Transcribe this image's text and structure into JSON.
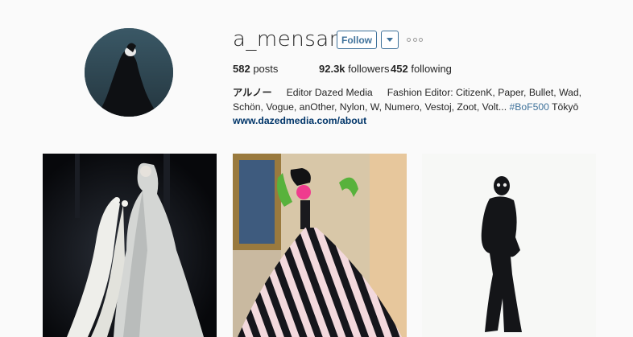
{
  "profile": {
    "username": "a_mensan",
    "follow_label": "Follow"
  },
  "stats": {
    "posts_count": "582",
    "posts_label": "posts",
    "followers_count": "92.3k",
    "followers_label": "followers",
    "following_count": "452",
    "following_label": "following"
  },
  "bio": {
    "name": "アルノー",
    "title": "Editor Dazed Media",
    "line1_rest": "Fashion Editor: CitizenK, Paper, Bullet, Wad,",
    "line2_text": "Schön, Vogue, anOther, Nylon, W, Numero, Vestoj, Zoot, Volt...",
    "hashtag": "#BoF500",
    "location": "Tōkyō",
    "website": "www.dazedmedia.com/about"
  },
  "icons": {
    "more": "more-options-icon",
    "dropdown": "chevron-down-icon"
  },
  "colors": {
    "accent": "#3f729b",
    "link": "#003569",
    "background": "#fafafa",
    "text": "#262626"
  }
}
